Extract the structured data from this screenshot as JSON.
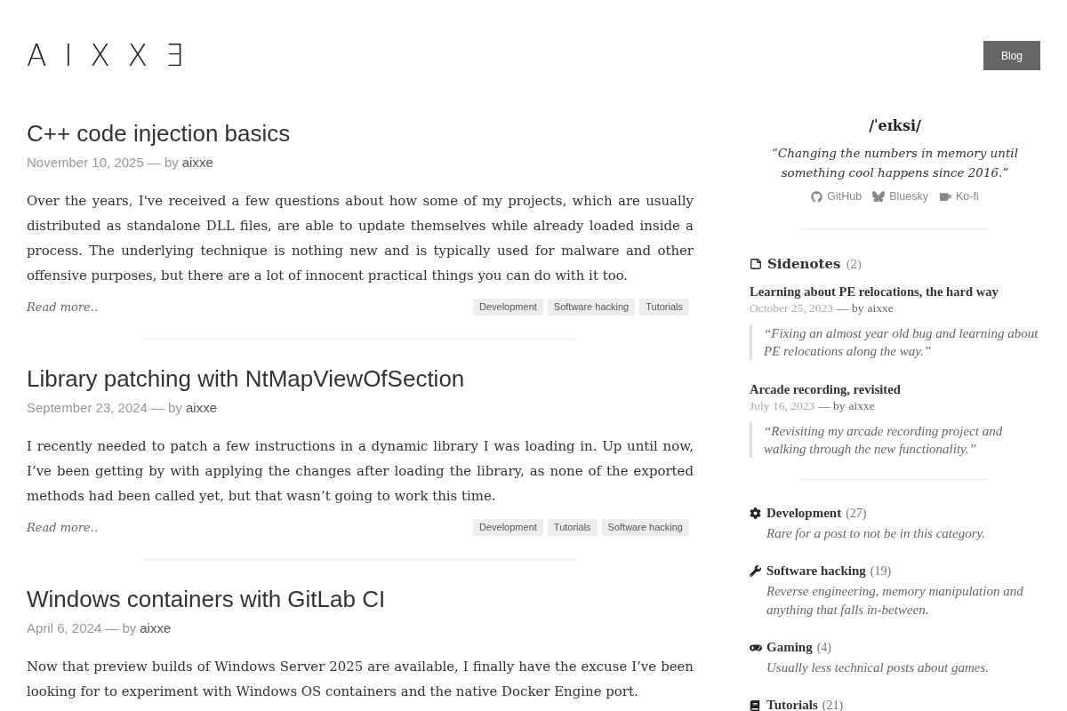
{
  "header": {
    "logo": "AIXXƎ",
    "nav_button": "Blog"
  },
  "posts": [
    {
      "title": "C++ code injection basics",
      "date": "November 10, 2025",
      "by": "— by",
      "author": "aixxe",
      "excerpt": "Over the years, I've received a few questions about how some of my projects, which are usually distributed as standalone DLL files, are able to update themselves while already loaded inside a process. The underlying technique is nothing new and is typically used for malware and other offensive purposes, but there are a lot of innocent practical things you can do with it too.",
      "read_more": "Read more..",
      "tags": [
        "Development",
        "Software hacking",
        "Tutorials"
      ]
    },
    {
      "title": "Library patching with NtMapViewOfSection",
      "date": "September 23, 2024",
      "by": "— by",
      "author": "aixxe",
      "excerpt": "I recently needed to patch a few instructions in a dynamic library I was loading in. Up until now, I’ve been getting by with applying the changes after loading the library, as none of the exported methods had been called yet, but that wasn’t going to work this time.",
      "read_more": "Read more..",
      "tags": [
        "Development",
        "Tutorials",
        "Software hacking"
      ]
    },
    {
      "title": "Windows containers with GitLab CI",
      "date": "April 6, 2024",
      "by": "— by",
      "author": "aixxe",
      "excerpt": "Now that preview builds of Windows Server 2025 are available, I finally have the excuse I’ve been looking for to experiment with Windows OS containers and the native Docker Engine port."
    }
  ],
  "sidebar": {
    "pronunciation": "/ˈeɪksi/",
    "tagline": "“Changing the numbers in memory until something cool happens since 2016.”",
    "links": [
      {
        "kind": "github",
        "label": "GitHub"
      },
      {
        "kind": "bluesky",
        "label": "Bluesky"
      },
      {
        "kind": "kofi",
        "label": "Ko-fi"
      }
    ],
    "sidenotes": {
      "heading": "Sidenotes",
      "count": "(2)",
      "items": [
        {
          "title": "Learning about PE relocations, the hard way",
          "date": "October 25, 2023",
          "by": "— by",
          "author": "aixxe",
          "summary": "“Fixing an almost year old bug and learning about PE relocations along the way.”"
        },
        {
          "title": "Arcade recording, revisited",
          "date": "July 16, 2023",
          "by": "— by",
          "author": "aixxe",
          "summary": "“Revisiting my arcade recording project and walking through the new functionality.”"
        }
      ]
    },
    "categories": [
      {
        "kind": "development",
        "name": "Development",
        "count": "(27)",
        "description": "Rare for a post to not be in this category."
      },
      {
        "kind": "hacking",
        "name": "Software hacking",
        "count": "(19)",
        "description": "Reverse engineering, memory manipulation and anything that falls in-between."
      },
      {
        "kind": "gaming",
        "name": "Gaming",
        "count": "(4)",
        "description": "Usually less technical posts about games."
      },
      {
        "kind": "tutorials",
        "name": "Tutorials",
        "count": "(21)"
      }
    ]
  }
}
